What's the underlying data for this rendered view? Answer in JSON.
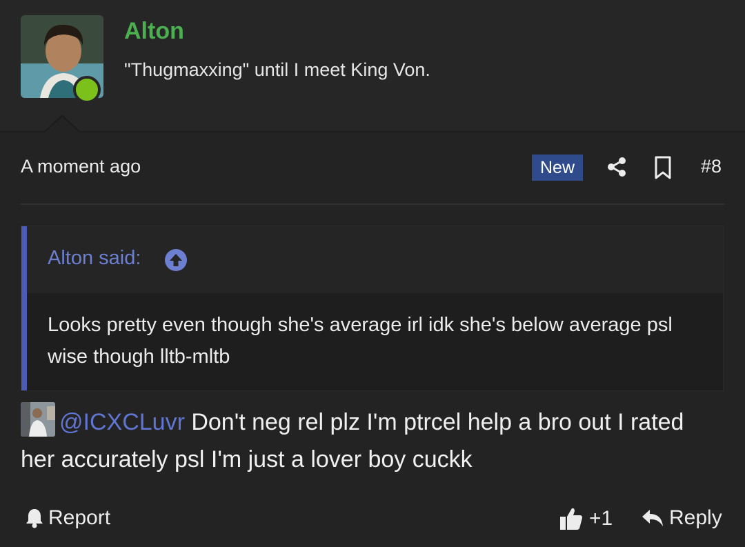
{
  "user": {
    "name": "Alton",
    "title": "\"Thugmaxxing\" until I meet King Von.",
    "status": "online",
    "name_color": "#4caf50"
  },
  "post": {
    "timestamp": "A moment ago",
    "badge": "New",
    "number": "#8",
    "icons": [
      "share-icon",
      "bookmark-icon"
    ]
  },
  "quote": {
    "author": "Alton said:",
    "text": "Looks pretty even though she's average irl idk she's below average psl wise though lltb-mltb",
    "accent": "#4d5bb5"
  },
  "message": {
    "mention": "@ICXCLuvr",
    "text": " Don't neg rel plz I'm ptrcel help a bro out I rated her accurately psl I'm just a lover boy cuckk"
  },
  "footer": {
    "report": "Report",
    "like_count": "+1",
    "reply": "Reply"
  }
}
